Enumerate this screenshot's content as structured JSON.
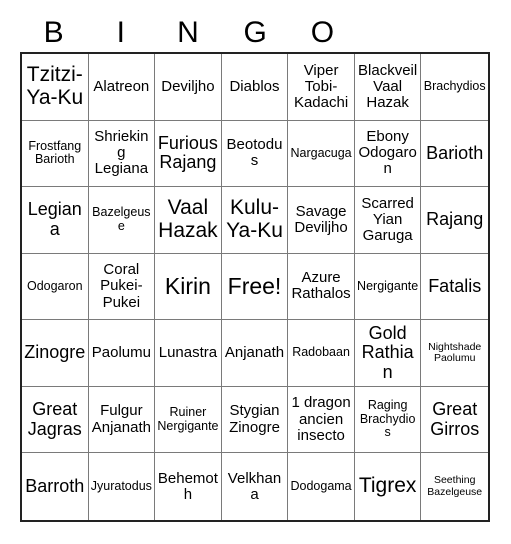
{
  "header": {
    "letters": [
      "B",
      "I",
      "N",
      "G",
      "O"
    ],
    "title": "BINGO"
  },
  "grid": {
    "columns": 7,
    "rows": 7,
    "free_space": "Free!",
    "cells": [
      [
        {
          "label": "Tzitzi-Ya-Ku",
          "size": "xl"
        },
        {
          "label": "Alatreon",
          "size": "m"
        },
        {
          "label": "Deviljho",
          "size": "m"
        },
        {
          "label": "Diablos",
          "size": "m"
        },
        {
          "label": "Viper Tobi-Kadachi",
          "size": "m"
        },
        {
          "label": "Blackveil Vaal Hazak",
          "size": "m"
        },
        {
          "label": "Brachydios",
          "size": "s"
        }
      ],
      [
        {
          "label": "Frostfang Barioth",
          "size": "s"
        },
        {
          "label": "Shrieking Legiana",
          "size": "m"
        },
        {
          "label": "Furious Rajang",
          "size": "l"
        },
        {
          "label": "Beotodus",
          "size": "m"
        },
        {
          "label": "Nargacuga",
          "size": "s"
        },
        {
          "label": "Ebony Odogaron",
          "size": "m"
        },
        {
          "label": "Barioth",
          "size": "l"
        }
      ],
      [
        {
          "label": "Legiana",
          "size": "l"
        },
        {
          "label": "Bazelgeuse",
          "size": "s"
        },
        {
          "label": "Vaal Hazak",
          "size": "xl"
        },
        {
          "label": "Kulu-Ya-Ku",
          "size": "xl"
        },
        {
          "label": "Savage Deviljho",
          "size": "m"
        },
        {
          "label": "Scarred Yian Garuga",
          "size": "m"
        },
        {
          "label": "Rajang",
          "size": "l"
        }
      ],
      [
        {
          "label": "Odogaron",
          "size": "s"
        },
        {
          "label": "Coral Pukei-Pukei",
          "size": "m"
        },
        {
          "label": "Kirin",
          "size": "xxl"
        },
        {
          "label": "Free!",
          "size": "xxl"
        },
        {
          "label": "Azure Rathalos",
          "size": "m"
        },
        {
          "label": "Nergigante",
          "size": "s"
        },
        {
          "label": "Fatalis",
          "size": "l"
        }
      ],
      [
        {
          "label": "Zinogre",
          "size": "l"
        },
        {
          "label": "Paolumu",
          "size": "m"
        },
        {
          "label": "Lunastra",
          "size": "m"
        },
        {
          "label": "Anjanath",
          "size": "m"
        },
        {
          "label": "Radobaan",
          "size": "s"
        },
        {
          "label": "Gold Rathian",
          "size": "l"
        },
        {
          "label": "Nightshade Paolumu",
          "size": "xs"
        }
      ],
      [
        {
          "label": "Great Jagras",
          "size": "l"
        },
        {
          "label": "Fulgur Anjanath",
          "size": "m"
        },
        {
          "label": "Ruiner Nergigante",
          "size": "s"
        },
        {
          "label": "Stygian Zinogre",
          "size": "m"
        },
        {
          "label": "1 dragon ancien insecto",
          "size": "m"
        },
        {
          "label": "Raging Brachydios",
          "size": "s"
        },
        {
          "label": "Great Girros",
          "size": "l"
        }
      ],
      [
        {
          "label": "Barroth",
          "size": "l"
        },
        {
          "label": "Jyuratodus",
          "size": "s"
        },
        {
          "label": "Behemoth",
          "size": "m"
        },
        {
          "label": "Velkhana",
          "size": "m"
        },
        {
          "label": "Dodogama",
          "size": "s"
        },
        {
          "label": "Tigrex",
          "size": "xl"
        },
        {
          "label": "Seething Bazelgeuse",
          "size": "xs"
        }
      ]
    ]
  },
  "colors": {
    "background": "#ffffff",
    "text": "#000000",
    "grid_outer_border": "#222222",
    "grid_inner_border": "#7a7a7a"
  }
}
